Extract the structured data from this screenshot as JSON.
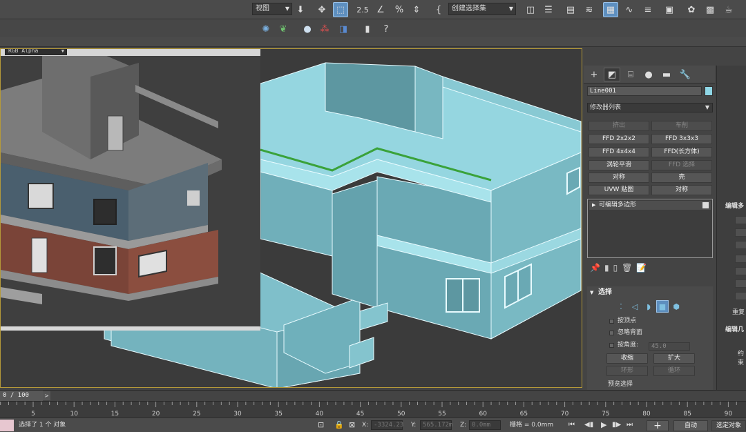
{
  "toolbar": {
    "view_dropdown": "视图",
    "selection_set": "创建选择集",
    "snap_label": "2.5",
    "icons": [
      "select-move-icon",
      "select-and-move-icon",
      "snap-toggle-icon",
      "angle-snap-icon",
      "percent-snap-icon",
      "spinner-snap-icon",
      "edit-named-selection-icon",
      "mirror-icon",
      "align-icon",
      "layer-manager-icon",
      "ribbon-icon",
      "curve-editor-icon",
      "schematic-view-icon",
      "material-editor-icon",
      "render-setup-icon",
      "rendered-frame-icon",
      "render-icon"
    ]
  },
  "render_window": {
    "channel": "RGB Alpha"
  },
  "command_panel": {
    "object_name": "Line001",
    "object_color": "#8fd7e6",
    "modifier_list": "修改器列表",
    "modifier_buttons": [
      {
        "label": "挤出",
        "enabled": false
      },
      {
        "label": "车削",
        "enabled": false
      },
      {
        "label": "FFD 2x2x2",
        "enabled": true
      },
      {
        "label": "FFD 3x3x3",
        "enabled": true
      },
      {
        "label": "FFD 4x4x4",
        "enabled": true
      },
      {
        "label": "FFD(长方体)",
        "enabled": true
      },
      {
        "label": "涡轮平滑",
        "enabled": true
      },
      {
        "label": "FFD 选择",
        "enabled": false
      },
      {
        "label": "对称",
        "enabled": true
      },
      {
        "label": "壳",
        "enabled": true
      },
      {
        "label": "UVW 贴图",
        "enabled": true
      },
      {
        "label": "对称",
        "enabled": true
      }
    ],
    "stack_item": "可编辑多边形",
    "selection": {
      "title": "选择",
      "by_vertex": "按顶点",
      "ignore_backfacing": "忽略背面",
      "by_angle": "按角度:",
      "angle_value": "45.0",
      "shrink": "收缩",
      "grow": "扩大",
      "ring": "环形",
      "loop": "循环",
      "preview": "预览选择"
    }
  },
  "right_strip": {
    "edit_poly": "编辑多",
    "edit_geom": "编辑几",
    "restrict": "约束",
    "repeat": "重复"
  },
  "timeline": {
    "frame": "0 / 100",
    "ticks": [
      "5",
      "10",
      "15",
      "20",
      "25",
      "30",
      "35",
      "40",
      "45",
      "50",
      "55",
      "60",
      "65",
      "70",
      "75",
      "80",
      "85",
      "90"
    ]
  },
  "status": {
    "selection_text": "选择了 1 个 对象",
    "x_label": "X:",
    "x_value": "-3324.23",
    "y_label": "Y:",
    "y_value": "565.172m",
    "z_label": "Z:",
    "z_value": "0.0mm",
    "grid_label": "栅格 = 0.0mm",
    "auto_key": "自动",
    "set_key": "选定对象"
  }
}
